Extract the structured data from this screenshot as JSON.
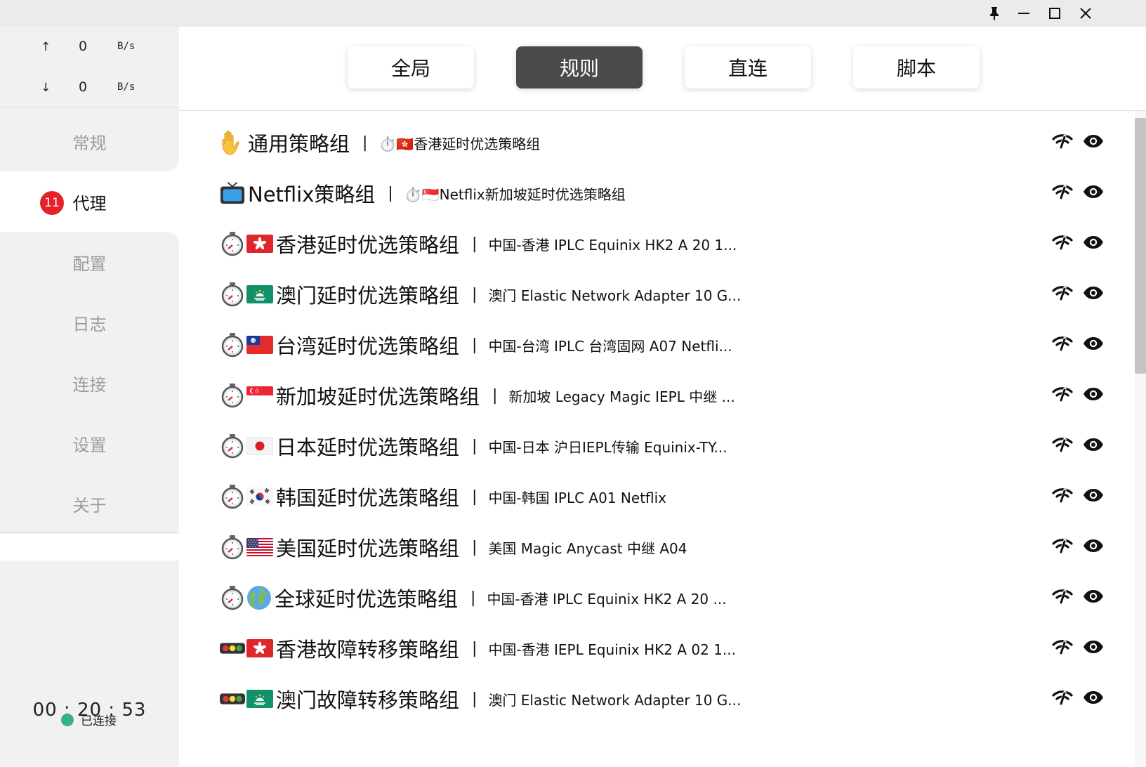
{
  "speed": {
    "up_arrow": "↑",
    "up_value": "0",
    "up_unit": "B/s",
    "down_arrow": "↓",
    "down_value": "0",
    "down_unit": "B/s"
  },
  "nav": {
    "items": [
      {
        "label": "常规"
      },
      {
        "label": "代理",
        "badge": "11"
      },
      {
        "label": "配置"
      },
      {
        "label": "日志"
      },
      {
        "label": "连接"
      },
      {
        "label": "设置"
      },
      {
        "label": "关于"
      }
    ]
  },
  "footer": {
    "timer": "00 : 20 : 53",
    "status": "已连接"
  },
  "modes": {
    "global": "全局",
    "rule": "规则",
    "direct": "直连",
    "script": "脚本"
  },
  "groups": [
    {
      "name": "通用策略组",
      "now": "⏱️🇭🇰香港延时优选策略组"
    },
    {
      "name": "Netflix策略组",
      "now": "⏱️🇸🇬Netflix新加坡延时优选策略组"
    },
    {
      "name": "香港延时优选策略组",
      "now": "中国-香港 IPLC Equinix HK2 A 20 1..."
    },
    {
      "name": "澳门延时优选策略组",
      "now": "澳门 Elastic Network Adapter 10 G..."
    },
    {
      "name": "台湾延时优选策略组",
      "now": "中国-台湾 IPLC 台湾固网 A07 Netfli..."
    },
    {
      "name": "新加坡延时优选策略组",
      "now": "新加坡 Legacy Magic IEPL 中继 ..."
    },
    {
      "name": "日本延时优选策略组",
      "now": "中国-日本 沪日IEPL传输 Equinix-TY..."
    },
    {
      "name": "韩国延时优选策略组",
      "now": "中国-韩国 IPLC A01 Netflix"
    },
    {
      "name": "美国延时优选策略组",
      "now": "美国 Magic Anycast 中继 A04"
    },
    {
      "name": "全球延时优选策略组",
      "now": "中国-香港 IPLC Equinix HK2 A 20 ..."
    },
    {
      "name": "香港故障转移策略组",
      "now": "中国-香港 IEPL Equinix HK2 A 02 1..."
    },
    {
      "name": "澳门故障转移策略组",
      "now": "澳门 Elastic Network Adapter 10 G..."
    }
  ],
  "separator": "|",
  "icons": {
    "window": [
      "pin-icon",
      "minimize-icon",
      "maximize-icon",
      "close-icon"
    ],
    "row_actions": [
      "latency-test-icon",
      "visibility-eye-icon"
    ]
  },
  "colors": {
    "badge": "#e5222a",
    "status_dot": "#36b37e",
    "selected_mode": "#4a4a4a"
  }
}
